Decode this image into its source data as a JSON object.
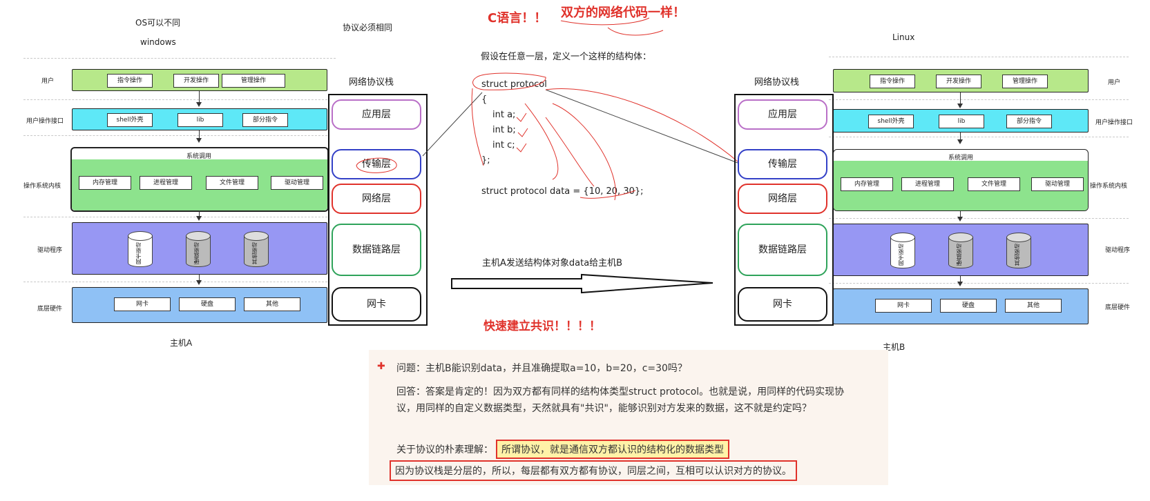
{
  "title_c": "C语言！！",
  "title_same": "双方的网络代码一样！",
  "left": {
    "os_label": "OS可以不同",
    "os_name": "windows",
    "protocol_note": "协议必须相同",
    "stack_title": "网络协议栈",
    "host": "主机A",
    "rows": {
      "user": "用户",
      "interface": "用户操作接口",
      "kernel": "操作系统内核",
      "driver": "驱动程序",
      "hardware": "底层硬件"
    },
    "user_items": [
      "指令操作",
      "开发操作",
      "管理操作"
    ],
    "interface_items": [
      "shell外壳",
      "lib",
      "部分指令"
    ],
    "syscall": "系统调用",
    "kernel_items": [
      "内存管理",
      "进程管理",
      "文件管理",
      "驱动管理"
    ],
    "drivers": [
      "网卡驱动",
      "硬盘驱动",
      "其他驱动"
    ],
    "hardware_items": [
      "网卡",
      "硬盘",
      "其他"
    ]
  },
  "right": {
    "os_name": "Linux",
    "stack_title": "网络协议栈",
    "host": "主机B",
    "rows": {
      "user": "用户",
      "interface": "用户操作接口",
      "kernel": "操作系统内核",
      "driver": "驱动程序",
      "hardware": "底层硬件"
    },
    "user_items": [
      "指令操作",
      "开发操作",
      "管理操作"
    ],
    "interface_items": [
      "shell外壳",
      "lib",
      "部分指令"
    ],
    "syscall": "系统调用",
    "kernel_items": [
      "内存管理",
      "进程管理",
      "文件管理",
      "驱动管理"
    ],
    "drivers": [
      "网卡驱动",
      "硬盘驱动",
      "其他驱动"
    ],
    "hardware_items": [
      "网卡",
      "硬盘",
      "其他"
    ]
  },
  "stack_layers": [
    "应用层",
    "传输层",
    "网络层",
    "数据链路层",
    "网卡"
  ],
  "code": {
    "intro": "假设在任意一层，定义一个这样的结构体：",
    "lines": [
      "struct protocol",
      "{",
      "int a;",
      "int b;",
      "int c;",
      "};"
    ],
    "data_line": "struct protocol data = {10, 20, 30};"
  },
  "send_text": "主机A发送结构体对象data给主机B",
  "consensus": "快速建立共识！！！！",
  "qa": {
    "question": "问题：主机B能识别data，并且准确提取a=10，b=20，c=30吗？",
    "answer_1": "回答：答案是肯定的！因为双方都有同样的结构体类型struct protocol。也就是说，用同样的代码实现协",
    "answer_2": "议，用同样的自定义数据类型，天然就具有\"共识\"，能够识别对方发来的数据，这不就是约定吗？",
    "understand_prefix": "关于协议的朴素理解：",
    "understand_highlight": "所谓协议，就是通信双方都认识的结构化的数据类型",
    "layered": "因为协议栈是分层的，所以，每层都有双方都有协议，同层之间，互相可以认识对方的协议。"
  },
  "colors": {
    "red": "#e0322b",
    "green": "#b7e88a",
    "cyan": "#5ee8f7",
    "kernel_green": "#8de38d",
    "purple": "#9797f3",
    "blue": "#8fc1f5",
    "note_bg": "#fbf4ee",
    "highlight": "#fff2a8"
  }
}
